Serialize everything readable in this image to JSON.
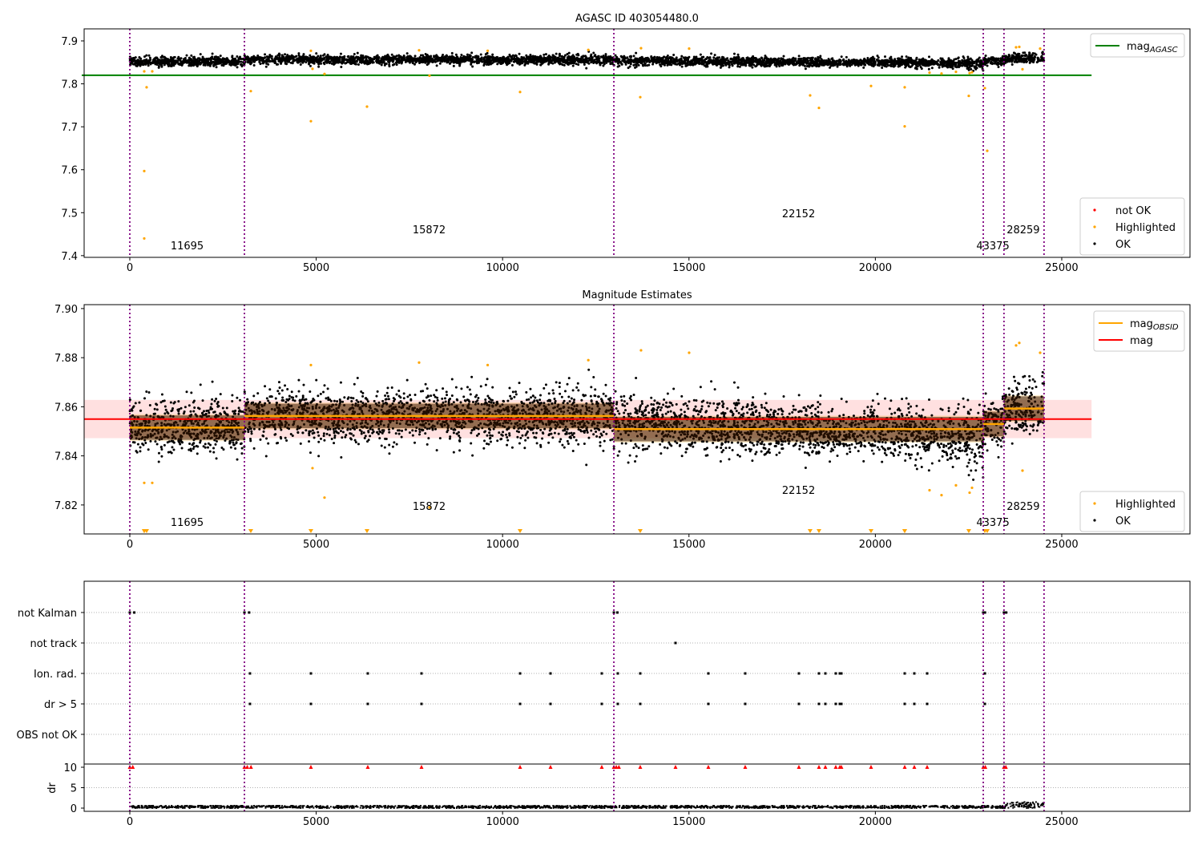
{
  "chart_data": [
    {
      "type": "scatter",
      "title": "AGASC ID 403054480.0",
      "xlim": [
        -1225,
        28440
      ],
      "ylim": [
        7.396,
        7.928
      ],
      "xticks": [
        0,
        5000,
        10000,
        15000,
        20000,
        25000
      ],
      "yticks": [
        7.4,
        7.5,
        7.6,
        7.7,
        7.8,
        7.9
      ],
      "mag_agasc": 7.82,
      "legend_lines": [
        {
          "label": "mag",
          "sub": "AGASC",
          "color": "#008000"
        }
      ],
      "legend_points": [
        {
          "label": "not OK",
          "color": "#ff0000"
        },
        {
          "label": "Highlighted",
          "color": "#ffa500"
        },
        {
          "label": "OK",
          "color": "#000000"
        }
      ],
      "highlighted": [
        [
          387,
          7.597
        ],
        [
          387,
          7.44
        ],
        [
          451,
          7.792
        ],
        [
          3246,
          7.783
        ],
        [
          4858,
          7.713
        ],
        [
          6363,
          7.747
        ],
        [
          10469,
          7.781
        ],
        [
          13693,
          7.769
        ],
        [
          18250,
          7.773
        ],
        [
          18487,
          7.744
        ],
        [
          19884,
          7.795
        ],
        [
          20787,
          7.792
        ],
        [
          20787,
          7.701
        ],
        [
          22506,
          7.772
        ],
        [
          23001,
          7.644
        ],
        [
          22937,
          7.79
        ]
      ]
    },
    {
      "type": "scatter",
      "title": "Magnitude Estimates",
      "xlim": [
        -1225,
        28440
      ],
      "ylim": [
        7.8082,
        7.9016
      ],
      "xticks": [
        0,
        5000,
        10000,
        15000,
        20000,
        25000
      ],
      "yticks": [
        7.82,
        7.84,
        7.86,
        7.88,
        7.9
      ],
      "mag": 7.855,
      "mag_band": [
        7.8472,
        7.8628
      ],
      "legend_lines": [
        {
          "label": "mag",
          "sub": "OBSID",
          "color": "#ffa500"
        },
        {
          "label": "mag",
          "sub": "",
          "color": "#ff0000"
        }
      ],
      "legend_points": [
        {
          "label": "Highlighted",
          "color": "#ffa500"
        },
        {
          "label": "OK",
          "color": "#000000"
        }
      ],
      "highlighted": [
        [
          387,
          7.829
        ],
        [
          602,
          7.829
        ],
        [
          4901,
          7.835
        ],
        [
          5223,
          7.823
        ],
        [
          8039,
          7.819
        ],
        [
          21453,
          7.826
        ],
        [
          21775,
          7.824
        ],
        [
          22162,
          7.828
        ],
        [
          22528,
          7.825
        ],
        [
          22593,
          7.827
        ],
        [
          23775,
          7.885
        ],
        [
          23861,
          7.886
        ],
        [
          23947,
          7.834
        ],
        [
          24420,
          7.882
        ],
        [
          13714,
          7.883
        ],
        [
          15004,
          7.882
        ],
        [
          4858,
          7.877
        ],
        [
          7760,
          7.878
        ],
        [
          9600,
          7.877
        ],
        [
          12300,
          7.879
        ]
      ]
    },
    {
      "type": "scatter",
      "xlim": [
        -1225,
        28440
      ],
      "xticks": [
        0,
        5000,
        10000,
        15000,
        20000,
        25000
      ],
      "categories": [
        "not Kalman",
        "not track",
        "Ion. rad.",
        "dr > 5",
        "OBS not OK"
      ],
      "ylabel": "dr",
      "dr_ticks": [
        0,
        5,
        10
      ],
      "dr_ylim": [
        -0.8,
        10.5
      ],
      "flags": {
        "not Kalman": [
          0,
          120,
          3075,
          3200,
          12985,
          13080,
          22895,
          22940,
          23450,
          23510
        ],
        "not track": [
          14639
        ],
        "Ion. rad.": [
          3224,
          4858,
          6384,
          7825,
          10469,
          11286,
          12661,
          13091,
          13693,
          15520,
          16509,
          17949,
          18487,
          18659,
          18938,
          19046,
          19089,
          20787,
          21045,
          21389,
          22937
        ],
        "dr > 5": [
          3224,
          4858,
          6384,
          7825,
          10469,
          11286,
          12661,
          13091,
          13693,
          15520,
          16509,
          17949,
          18487,
          18659,
          18938,
          19046,
          19089,
          20787,
          21045,
          21389,
          22937
        ]
      },
      "dr_gt10_x": [
        0,
        80,
        3075,
        3150,
        3250,
        12985,
        13050,
        13120,
        22895,
        22950,
        23450,
        23500,
        4858,
        6384,
        7825,
        10469,
        11286,
        12661,
        13693,
        14639,
        15520,
        16509,
        17949,
        18487,
        18659,
        18938,
        19046,
        19089,
        19884,
        20787,
        21045,
        21389
      ]
    }
  ],
  "observations": {
    "boundaries": [
      0,
      3075,
      12985,
      22895,
      23450,
      24525
    ],
    "segments": [
      {
        "obsid": "11695",
        "start": 0,
        "end": 3075,
        "mean": 7.8515,
        "trend_end": 7.8515
      },
      {
        "obsid": "15872",
        "start": 3075,
        "end": 12985,
        "mean": 7.8565,
        "trend_end": 7.856
      },
      {
        "obsid": "22152",
        "start": 12985,
        "end": 22895,
        "mean": 7.8543,
        "trend_end": 7.8475
      },
      {
        "obsid": "43375",
        "start": 22895,
        "end": 23450,
        "mean": 7.853,
        "trend_end": 7.853
      },
      {
        "obsid": "28259",
        "start": 23450,
        "end": 24525,
        "mean": 7.8585,
        "trend_end": 7.86
      }
    ],
    "scatter_std": 0.0055,
    "label_levels": {
      "11695": 0,
      "15872": 1,
      "22152": 2,
      "43375": 0,
      "28259": 1
    }
  }
}
